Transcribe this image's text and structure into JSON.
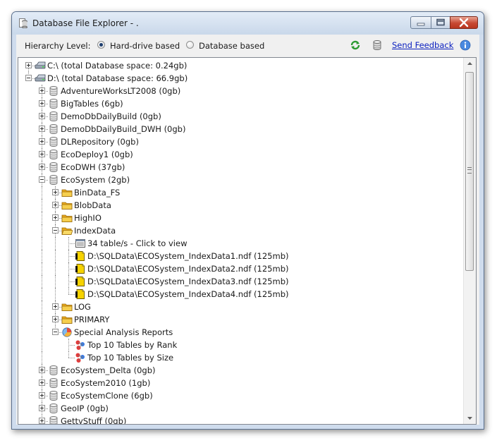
{
  "window": {
    "title": "Database File Explorer - ."
  },
  "toolbar": {
    "hierarchy_label": "Hierarchy Level:",
    "option_hard_drive": "Hard-drive based",
    "option_database": "Database based",
    "selected": "Hard-drive based",
    "feedback_link": "Send Feedback",
    "icons": [
      "refresh-icon",
      "database-icon",
      "info-icon"
    ]
  },
  "colors": {
    "link": "#0a1fbf",
    "folder": "#f3c12a",
    "datafile": "#f6d300",
    "titlebar": "#c9d8ea"
  },
  "tree": {
    "rows": [
      {
        "label": "C:\\ (total Database space: 0.24gb)",
        "icon": "drive-icon",
        "level": 0,
        "expander": "plus",
        "name": "tree-node-drive-c"
      },
      {
        "label": "D:\\ (total Database space: 66.9gb)",
        "icon": "drive-icon",
        "level": 0,
        "expander": "minus",
        "name": "tree-node-drive-d"
      },
      {
        "label": "AdventureWorksLT2008 (0gb)",
        "icon": "database-icon",
        "level": 1,
        "expander": "plus",
        "name": "tree-node-database"
      },
      {
        "label": "BigTables (6gb)",
        "icon": "database-icon",
        "level": 1,
        "expander": "plus",
        "name": "tree-node-database"
      },
      {
        "label": "DemoDbDailyBuild (0gb)",
        "icon": "database-icon",
        "level": 1,
        "expander": "plus",
        "name": "tree-node-database"
      },
      {
        "label": "DemoDbDailyBuild_DWH (0gb)",
        "icon": "database-icon",
        "level": 1,
        "expander": "plus",
        "name": "tree-node-database"
      },
      {
        "label": "DLRepository (0gb)",
        "icon": "database-icon",
        "level": 1,
        "expander": "plus",
        "name": "tree-node-database"
      },
      {
        "label": "EcoDeploy1 (0gb)",
        "icon": "database-icon",
        "level": 1,
        "expander": "plus",
        "name": "tree-node-database"
      },
      {
        "label": "EcoDWH (37gb)",
        "icon": "database-icon",
        "level": 1,
        "expander": "plus",
        "name": "tree-node-database"
      },
      {
        "label": "EcoSystem (2gb)",
        "icon": "database-icon",
        "level": 1,
        "expander": "minus",
        "name": "tree-node-database-ecosystem"
      },
      {
        "label": "BinData_FS",
        "icon": "folder-icon",
        "level": 2,
        "expander": "plus",
        "name": "tree-node-filegroup"
      },
      {
        "label": "BlobData",
        "icon": "folder-icon",
        "level": 2,
        "expander": "plus",
        "name": "tree-node-filegroup"
      },
      {
        "label": "HighIO",
        "icon": "folder-icon",
        "level": 2,
        "expander": "plus",
        "name": "tree-node-filegroup"
      },
      {
        "label": "IndexData",
        "icon": "folder-open-icon",
        "level": 2,
        "expander": "minus",
        "name": "tree-node-filegroup-indexdata"
      },
      {
        "label": "34 table/s - Click to view",
        "icon": "table-list-icon",
        "level": 3,
        "expander": "none",
        "name": "tree-node-table-list"
      },
      {
        "label": "D:\\SQLData\\ECOSystem_IndexData1.ndf (125mb)",
        "icon": "data-file-icon",
        "level": 3,
        "expander": "none",
        "name": "tree-node-data-file"
      },
      {
        "label": "D:\\SQLData\\ECOSystem_IndexData2.ndf (125mb)",
        "icon": "data-file-icon",
        "level": 3,
        "expander": "none",
        "name": "tree-node-data-file"
      },
      {
        "label": "D:\\SQLData\\ECOSystem_IndexData3.ndf (125mb)",
        "icon": "data-file-icon",
        "level": 3,
        "expander": "none",
        "name": "tree-node-data-file"
      },
      {
        "label": "D:\\SQLData\\ECOSystem_IndexData4.ndf (125mb)",
        "icon": "data-file-icon",
        "level": 3,
        "expander": "none",
        "name": "tree-node-data-file"
      },
      {
        "label": "LOG",
        "icon": "folder-icon",
        "level": 2,
        "expander": "plus",
        "name": "tree-node-filegroup"
      },
      {
        "label": "PRIMARY",
        "icon": "folder-icon",
        "level": 2,
        "expander": "plus",
        "name": "tree-node-filegroup"
      },
      {
        "label": "Special Analysis Reports",
        "icon": "reports-icon",
        "level": 2,
        "expander": "minus",
        "name": "tree-node-reports"
      },
      {
        "label": "Top 10 Tables by Rank",
        "icon": "report-icon",
        "level": 3,
        "expander": "none",
        "name": "tree-node-report"
      },
      {
        "label": "Top 10 Tables by Size",
        "icon": "report-icon",
        "level": 3,
        "expander": "none",
        "name": "tree-node-report"
      },
      {
        "label": "EcoSystem_Delta (0gb)",
        "icon": "database-icon",
        "level": 1,
        "expander": "plus",
        "name": "tree-node-database"
      },
      {
        "label": "EcoSystem2010 (1gb)",
        "icon": "database-icon",
        "level": 1,
        "expander": "plus",
        "name": "tree-node-database"
      },
      {
        "label": "EcoSystemClone (6gb)",
        "icon": "database-icon",
        "level": 1,
        "expander": "plus",
        "name": "tree-node-database"
      },
      {
        "label": "GeoIP (0gb)",
        "icon": "database-icon",
        "level": 1,
        "expander": "plus",
        "name": "tree-node-database"
      },
      {
        "label": "GettyStuff (0gb)",
        "icon": "database-icon",
        "level": 1,
        "expander": "plus",
        "name": "tree-node-database"
      }
    ]
  }
}
